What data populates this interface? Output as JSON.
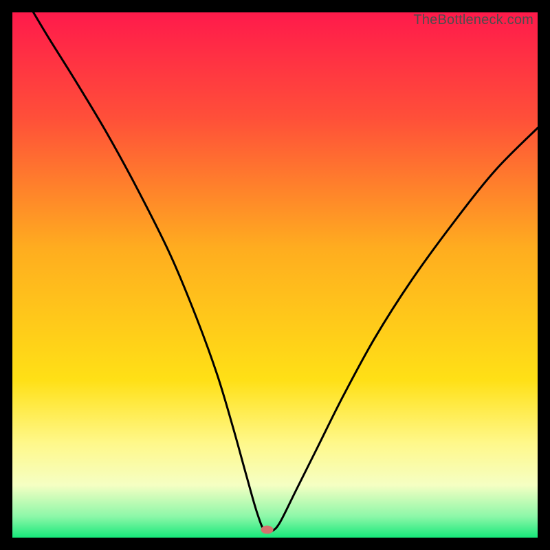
{
  "watermark": "TheBottleneck.com",
  "chart_data": {
    "type": "line",
    "title": "",
    "xlabel": "",
    "ylabel": "",
    "xlim": [
      0,
      100
    ],
    "ylim": [
      0,
      100
    ],
    "grid": false,
    "legend": false,
    "background_gradient_stops": [
      {
        "offset": 0.0,
        "color": "#ff1a4b"
      },
      {
        "offset": 0.2,
        "color": "#ff4f39"
      },
      {
        "offset": 0.45,
        "color": "#ffad1f"
      },
      {
        "offset": 0.7,
        "color": "#ffe016"
      },
      {
        "offset": 0.82,
        "color": "#fff88a"
      },
      {
        "offset": 0.9,
        "color": "#f5ffc3"
      },
      {
        "offset": 0.96,
        "color": "#8cf7a8"
      },
      {
        "offset": 1.0,
        "color": "#17e87a"
      }
    ],
    "marker": {
      "x": 48.5,
      "y": 1.5,
      "color": "#d4736e"
    },
    "series": [
      {
        "name": "bottleneck-curve",
        "color": "#000000",
        "points": [
          {
            "x": 4.0,
            "y": 100.0
          },
          {
            "x": 7.0,
            "y": 95.0
          },
          {
            "x": 12.0,
            "y": 87.0
          },
          {
            "x": 18.0,
            "y": 77.0
          },
          {
            "x": 24.0,
            "y": 66.0
          },
          {
            "x": 30.0,
            "y": 54.0
          },
          {
            "x": 35.0,
            "y": 42.0
          },
          {
            "x": 39.0,
            "y": 31.0
          },
          {
            "x": 42.0,
            "y": 21.0
          },
          {
            "x": 44.5,
            "y": 12.0
          },
          {
            "x": 46.5,
            "y": 5.0
          },
          {
            "x": 48.0,
            "y": 1.3
          },
          {
            "x": 49.5,
            "y": 1.3
          },
          {
            "x": 51.0,
            "y": 3.0
          },
          {
            "x": 54.0,
            "y": 9.0
          },
          {
            "x": 58.0,
            "y": 17.0
          },
          {
            "x": 63.0,
            "y": 27.0
          },
          {
            "x": 69.0,
            "y": 38.0
          },
          {
            "x": 76.0,
            "y": 49.0
          },
          {
            "x": 84.0,
            "y": 60.0
          },
          {
            "x": 92.0,
            "y": 70.0
          },
          {
            "x": 100.0,
            "y": 78.0
          }
        ]
      }
    ]
  }
}
